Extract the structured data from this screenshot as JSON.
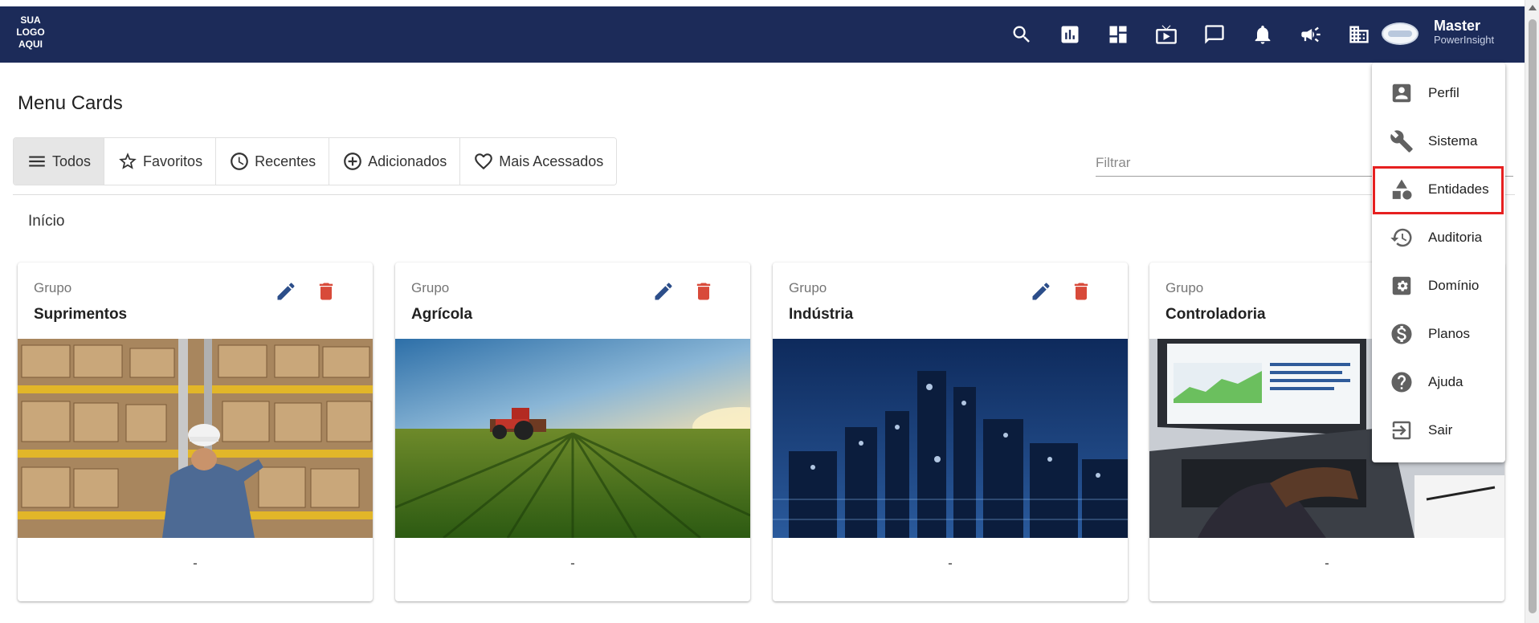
{
  "header": {
    "logo_text": "SUA LOGO AQUI",
    "icons": [
      "search-icon",
      "chart-icon",
      "dashboard-icon",
      "tv-icon",
      "chat-icon",
      "bell-icon",
      "megaphone-icon",
      "building-icon"
    ],
    "user_name": "Master",
    "user_role": "PowerInsight",
    "bar_color": "#1c2b59"
  },
  "page": {
    "title": "Menu Cards",
    "breadcrumb": "Início",
    "filter_placeholder": "Filtrar"
  },
  "tabs": [
    {
      "label": "Todos",
      "icon": "menu-icon",
      "active": true
    },
    {
      "label": "Favoritos",
      "icon": "star-icon",
      "active": false
    },
    {
      "label": "Recentes",
      "icon": "clock-icon",
      "active": false
    },
    {
      "label": "Adicionados",
      "icon": "plus-circle-icon",
      "active": false
    },
    {
      "label": "Mais Acessados",
      "icon": "heart-icon",
      "active": false
    }
  ],
  "cards": [
    {
      "group_label": "Grupo",
      "title": "Suprimentos",
      "description": "-",
      "image": "warehouse-photo"
    },
    {
      "group_label": "Grupo",
      "title": "Agrícola",
      "description": "-",
      "image": "tractor-field-photo"
    },
    {
      "group_label": "Grupo",
      "title": "Indústria",
      "description": "-",
      "image": "refinery-photo"
    },
    {
      "group_label": "Grupo",
      "title": "Controladoria",
      "description": "-",
      "image": "laptop-finance-photo"
    }
  ],
  "user_menu": {
    "items": [
      {
        "label": "Perfil",
        "icon": "account-box-icon"
      },
      {
        "label": "Sistema",
        "icon": "wrench-icon"
      },
      {
        "label": "Entidades",
        "icon": "shapes-icon",
        "highlighted": true
      },
      {
        "label": "Auditoria",
        "icon": "history-icon"
      },
      {
        "label": "Domínio",
        "icon": "domain-settings-icon"
      },
      {
        "label": "Planos",
        "icon": "dollar-circle-icon"
      },
      {
        "label": "Ajuda",
        "icon": "help-icon"
      },
      {
        "label": "Sair",
        "icon": "logout-icon"
      }
    ],
    "highlight_color": "#e62020"
  },
  "colors": {
    "edit_icon": "#2c4e8a",
    "delete_icon": "#d84a3a"
  }
}
